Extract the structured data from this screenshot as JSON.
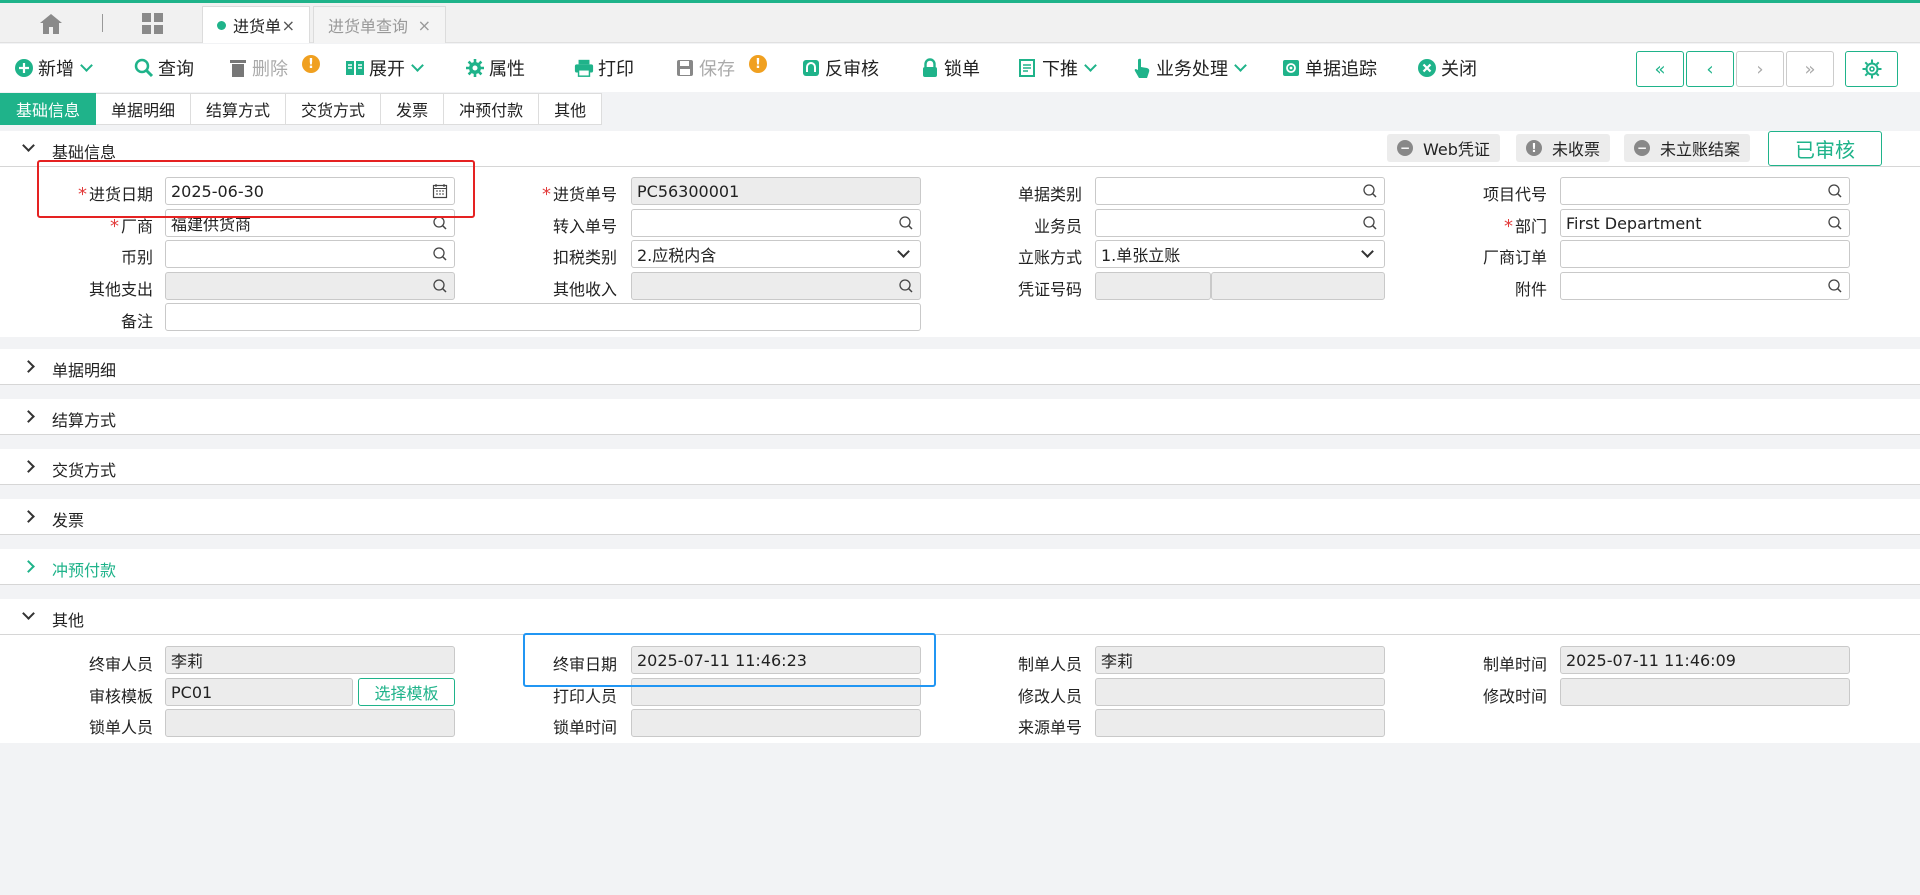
{
  "colors": {
    "accent": "#1fb38a",
    "required": "#e23b3b",
    "warn": "#f0a020"
  },
  "tabs": [
    {
      "label": "进货单",
      "close": "×"
    },
    {
      "label": "进货单查询",
      "close": "×"
    }
  ],
  "toolbar": {
    "new": "新增",
    "query": "查询",
    "delete": "删除",
    "expand": "展开",
    "properties": "属性",
    "print": "打印",
    "save": "保存",
    "unreview": "反审核",
    "lock": "锁单",
    "push_down": "下推",
    "business": "业务处理",
    "trace": "单据追踪",
    "close": "关闭",
    "warn_mark": "!",
    "nav": {
      "first": "«",
      "prev": "‹",
      "next": "›",
      "last": "»"
    }
  },
  "section_tabs": [
    "基础信息",
    "单据明细",
    "结算方式",
    "交货方式",
    "发票",
    "冲预付款",
    "其他"
  ],
  "sections": {
    "basic": "基础信息",
    "detail": "单据明细",
    "settlement": "结算方式",
    "delivery": "交货方式",
    "invoice": "发票",
    "prepay": "冲预付款",
    "other": "其他"
  },
  "badges": {
    "web_voucher": "Web凭证",
    "not_invoiced": "未收票",
    "not_settled": "未立账结案",
    "approved": "已审核",
    "minus": "−",
    "bang": "!"
  },
  "basic": {
    "purchase_date_label": "进货日期",
    "purchase_date": "2025-06-30",
    "purchase_no_label": "进货单号",
    "purchase_no": "PC56300001",
    "doc_type_label": "单据类别",
    "doc_type": "",
    "project_code_label": "项目代号",
    "project_code": "",
    "vendor_label": "厂商",
    "vendor": "福建供货商",
    "transfer_no_label": "转入单号",
    "transfer_no": "",
    "salesman_label": "业务员",
    "salesman": "",
    "dept_label": "部门",
    "dept": "First Department",
    "currency_label": "币别",
    "currency": "",
    "tax_type_label": "扣税类别",
    "tax_type": "2.应税内含",
    "account_method_label": "立账方式",
    "account_method": "1.单张立账",
    "vendor_order_label": "厂商订单",
    "vendor_order": "",
    "other_expense_label": "其他支出",
    "other_expense": "",
    "other_income_label": "其他收入",
    "other_income": "",
    "voucher_no_label": "凭证号码",
    "voucher_no_a": "",
    "voucher_no_b": "",
    "attachment_label": "附件",
    "attachment": "",
    "remark_label": "备注",
    "remark": "",
    "required_mark": "*"
  },
  "other": {
    "final_reviewer_label": "终审人员",
    "final_reviewer": "李莉",
    "final_review_date_label": "终审日期",
    "final_review_date": "2025-07-11 11:46:23",
    "creator_label": "制单人员",
    "creator": "李莉",
    "created_time_label": "制单时间",
    "created_time": "2025-07-11 11:46:09",
    "review_template_label": "审核模板",
    "review_template": "PC01",
    "select_template": "选择模板",
    "printer_label": "打印人员",
    "printer": "",
    "modifier_label": "修改人员",
    "modifier": "",
    "modified_time_label": "修改时间",
    "modified_time": "",
    "locker_label": "锁单人员",
    "locker": "",
    "lock_time_label": "锁单时间",
    "lock_time": "",
    "source_no_label": "来源单号",
    "source_no": ""
  }
}
